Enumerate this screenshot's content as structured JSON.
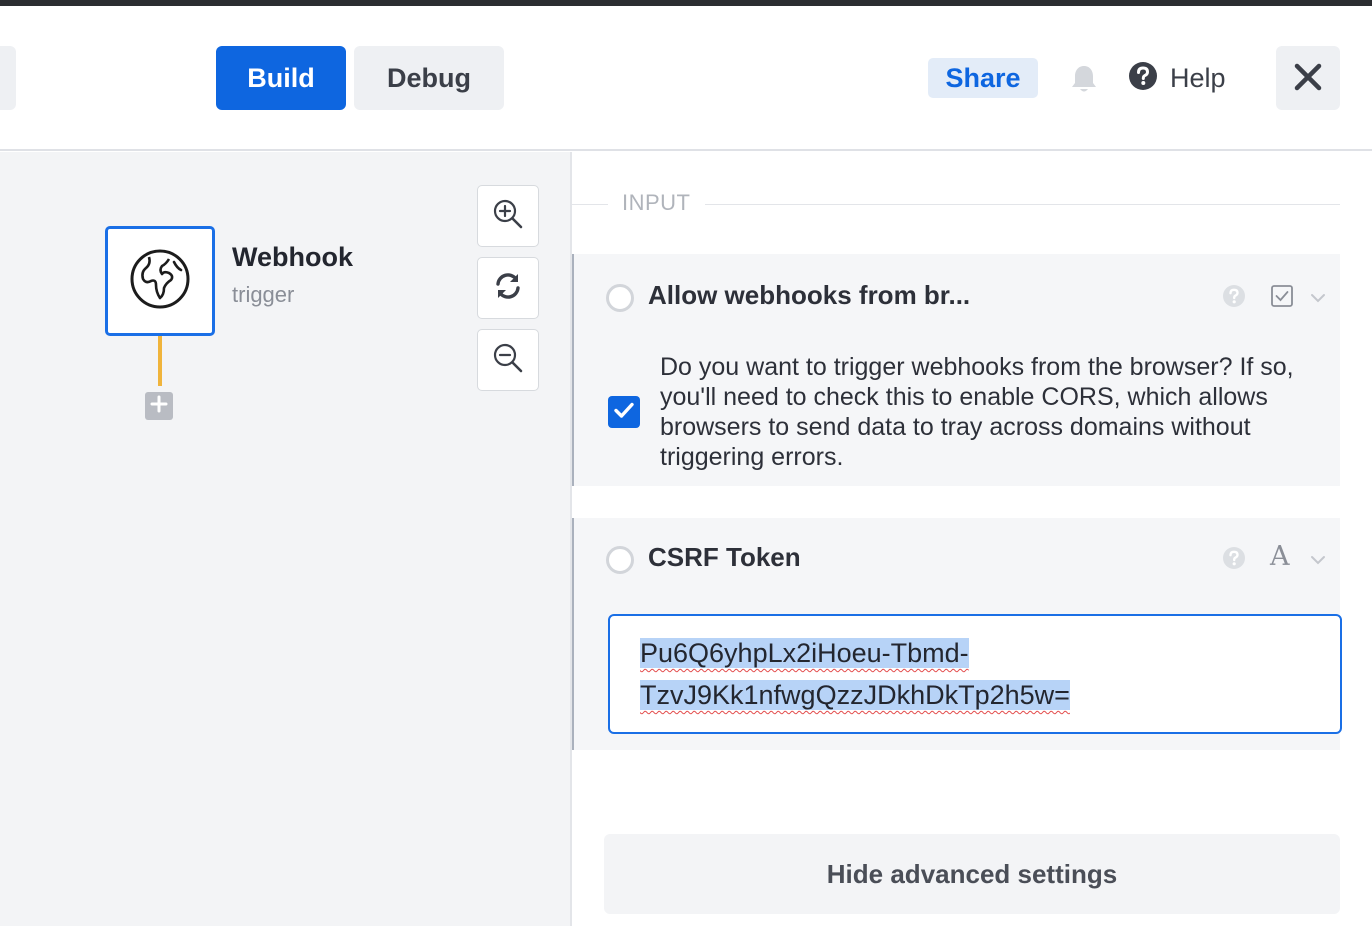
{
  "header": {
    "tabs": [
      {
        "label": "Build",
        "active": true
      },
      {
        "label": "Debug",
        "active": false
      }
    ],
    "share_label": "Share",
    "help_label": "Help"
  },
  "canvas": {
    "node": {
      "title": "Webhook",
      "subtitle": "trigger",
      "icon": "globe-icon"
    },
    "zoom_controls": [
      "zoom-in-icon",
      "refresh-icon",
      "zoom-out-icon"
    ]
  },
  "panel": {
    "section_label": "INPUT",
    "fields": [
      {
        "title": "Allow webhooks from br...",
        "type_icon": "checkbox-type-icon",
        "checked": true,
        "description": "Do you want to trigger webhooks from the browser? If so, you'll need to check this to enable CORS, which allows browsers to send data to tray across domains without triggering errors."
      },
      {
        "title": "CSRF Token",
        "type_icon": "text-type-icon",
        "type_glyph": "A",
        "value_line1": "Pu6Q6yhpLx2iHoeu-Tbmd-",
        "value_line2": "TzvJ9Kk1nfwgQzzJDkhDkTp2h5w="
      }
    ],
    "hide_advanced_label": "Hide advanced settings"
  },
  "colors": {
    "accent": "#0e66e0",
    "connector": "#f0b43c"
  }
}
